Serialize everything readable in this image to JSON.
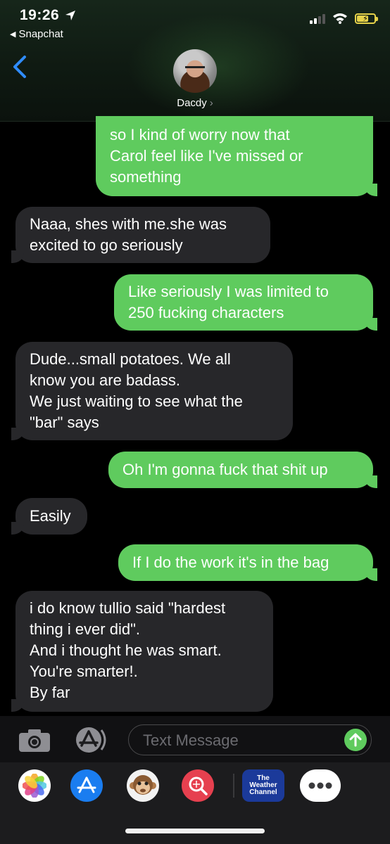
{
  "status_bar": {
    "time": "19:26",
    "back_app": "Snapchat"
  },
  "header": {
    "contact_name": "Dacdy",
    "chevron": "›"
  },
  "messages": [
    {
      "side": "sent",
      "text": "so I kind of worry now that\nCarol feel like I've missed or\nsomething"
    },
    {
      "side": "received",
      "text": "Naaa, shes with me.she was\nexcited to go seriously"
    },
    {
      "side": "sent",
      "text": "Like seriously I was limited to\n250 fucking characters"
    },
    {
      "side": "received",
      "text": "Dude...small potatoes. We all\nknow you are badass.\nWe just waiting to see what the\n\"bar\" says"
    },
    {
      "side": "sent",
      "text": "Oh I'm gonna fuck that shit up"
    },
    {
      "side": "received",
      "text": "Easily"
    },
    {
      "side": "sent",
      "text": "If I do the work it's in the bag"
    },
    {
      "side": "received",
      "text": "i do know tullio said \"hardest\nthing i ever did\".\nAnd i thought he was smart.\nYou're smarter!.\nBy far"
    }
  ],
  "input": {
    "placeholder": "Text Message"
  },
  "app_drawer": {
    "weather_label": "The\nWeather\nChannel",
    "icons": [
      "photos-icon",
      "app-store-icon",
      "animoji-icon",
      "web-search-icon",
      "weather-channel-icon",
      "more-icon"
    ]
  },
  "colors": {
    "sent_bubble": "#5fcb5e",
    "received_bubble": "#27272a",
    "accent_blue": "#1a7df0"
  }
}
